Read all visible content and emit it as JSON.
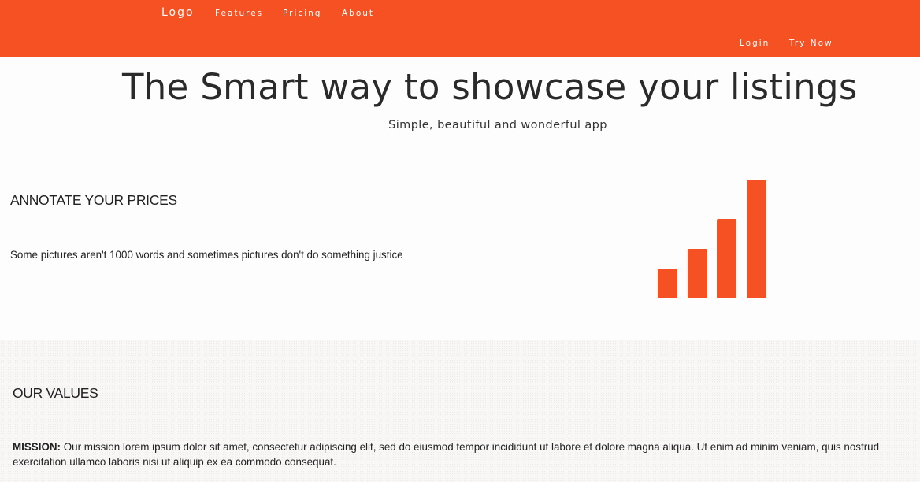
{
  "nav": {
    "logo": "Logo",
    "links": [
      "Features",
      "Pricing",
      "About"
    ],
    "login": "Login",
    "try_now": "Try Now"
  },
  "hero": {
    "title": "The Smart way to showcase your listings",
    "subtitle": "Simple, beautiful and wonderful app"
  },
  "feature": {
    "title": "ANNOTATE YOUR PRICES",
    "text": "Some pictures aren't 1000 words and sometimes pictures don't do something justice",
    "icon": "signal-bars-icon"
  },
  "values": {
    "title": "OUR VALUES",
    "mission_label": "MISSION:",
    "mission_text": "Our mission lorem ipsum dolor sit amet, consectetur adipiscing elit, sed do eiusmod tempor incididunt ut labore et dolore magna aliqua. Ut enim ad minim veniam, quis nostrud exercitation ullamco laboris nisi ut aliquip ex ea commodo consequat."
  },
  "colors": {
    "accent": "#f55122",
    "background": "#fdfdfd",
    "text": "#222222"
  }
}
